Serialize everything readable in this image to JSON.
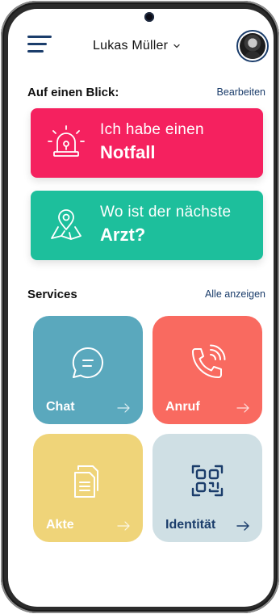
{
  "header": {
    "user_name": "Lukas Müller"
  },
  "at_a_glance": {
    "title": "Auf einen Blick:",
    "edit_label": "Bearbeiten",
    "cards": [
      {
        "line1": "Ich habe einen",
        "line2": "Notfall",
        "color": "#f5215f",
        "icon": "siren-icon"
      },
      {
        "line1": "Wo ist der nächste",
        "line2": "Arzt?",
        "color": "#1dbf9c",
        "icon": "map-pin-icon"
      }
    ]
  },
  "services": {
    "title": "Services",
    "show_all_label": "Alle anzeigen",
    "tiles": [
      {
        "label": "Chat",
        "color": "#5aa8bd",
        "icon": "chat-bubble-icon"
      },
      {
        "label": "Anruf",
        "color": "#f96a60",
        "icon": "phone-icon"
      },
      {
        "label": "Akte",
        "color": "#efd479",
        "icon": "documents-icon"
      },
      {
        "label": "Identität",
        "color": "#cfdfe4",
        "icon": "qr-code-icon"
      }
    ]
  }
}
